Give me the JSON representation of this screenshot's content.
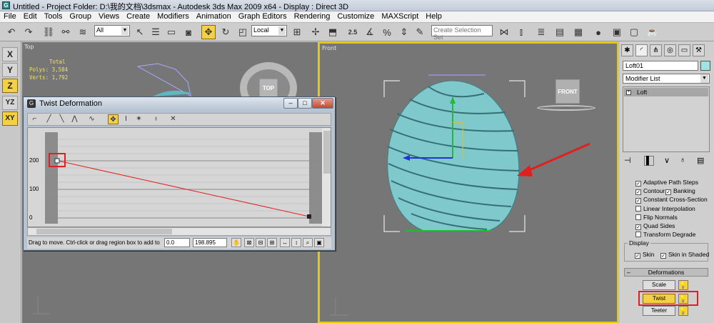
{
  "window": {
    "title": "Untitled    - Project Folder: D:\\我的文档\\3dsmax    - Autodesk 3ds Max  2009 x64    - Display : Direct 3D"
  },
  "menu": [
    "File",
    "Edit",
    "Tools",
    "Group",
    "Views",
    "Create",
    "Modifiers",
    "Animation",
    "Graph Editors",
    "Rendering",
    "Customize",
    "MAXScript",
    "Help"
  ],
  "toolbar": {
    "selection_filter": "All",
    "ref_coord": "Local",
    "selection_set_placeholder": "Create Selection Set",
    "snap_value": "2.5"
  },
  "axes": [
    "X",
    "Y",
    "Z",
    "YZ",
    "XY"
  ],
  "viewports": {
    "top": {
      "label": "Top",
      "viewcube": "TOP"
    },
    "front": {
      "label": "Front",
      "viewcube": "FRONT"
    }
  },
  "stats": {
    "total": "Total",
    "polys": "Polys: 3,584",
    "verts": "Verts: 1,792"
  },
  "twist_dialog": {
    "title": "Twist Deformation",
    "y_ticks": [
      "200",
      "100",
      "0"
    ],
    "status_text": "Drag to move. Ctrl-click or drag region box to add to s",
    "field1": "0.0",
    "field2": "198.895"
  },
  "command_panel": {
    "object_name": "Loft01",
    "modifier_list": "Modifier List",
    "stack_item": "Loft",
    "checkboxes": [
      {
        "label": "Adaptive Path Steps",
        "checked": true
      },
      {
        "label": "Contour",
        "checked": true
      },
      {
        "label": "Banking",
        "checked": true
      },
      {
        "label": "Constant Cross-Section",
        "checked": true
      },
      {
        "label": "Linear Interpolation",
        "checked": false
      },
      {
        "label": "Flip Normals",
        "checked": false
      },
      {
        "label": "Quad Sides",
        "checked": true
      },
      {
        "label": "Transform Degrade",
        "checked": false
      }
    ],
    "display_title": "Display",
    "display_skin": "Skin",
    "display_skin_shaded": "Skin in Shaded",
    "deformations_title": "Deformations",
    "deform_buttons": [
      "Scale",
      "Twist",
      "Teeter"
    ],
    "colors": {
      "highlight": "#e02020",
      "accent": "#f4d046",
      "mesh": "#7fc8cc"
    }
  }
}
